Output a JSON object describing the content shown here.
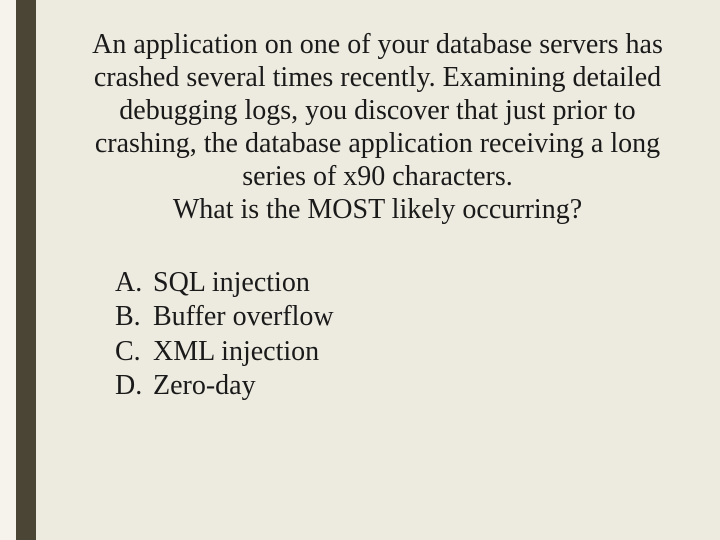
{
  "question": {
    "stem": "An application on one of your database servers has crashed several times recently. Examining detailed debugging logs, you discover that just prior to crashing, the database application receiving a long series of x90 characters.\nWhat is the MOST likely occurring?"
  },
  "options": [
    {
      "letter": "A.",
      "text": "SQL injection"
    },
    {
      "letter": "B.",
      "text": "Buffer overflow"
    },
    {
      "letter": "C.",
      "text": "XML injection"
    },
    {
      "letter": "D.",
      "text": "Zero-day"
    }
  ]
}
